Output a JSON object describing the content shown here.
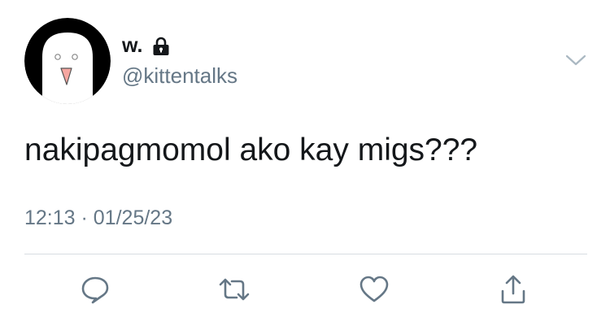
{
  "tweet": {
    "display_name": "w.",
    "handle": "@kittentalks",
    "text": "nakipagmomol ako kay migs???",
    "time": "12:13",
    "separator": "·",
    "date": "01/25/23",
    "protected_icon": "lock-icon",
    "avatar_icon": "ghost-face-avatar"
  },
  "actions": [
    {
      "icon": "reply-icon"
    },
    {
      "icon": "retweet-icon"
    },
    {
      "icon": "like-icon"
    },
    {
      "icon": "share-icon"
    }
  ],
  "colors": {
    "text_primary": "#14171a",
    "text_secondary": "#657786",
    "divider": "#d8dde2",
    "icon": "#657786",
    "avatar_bg": "#000000",
    "avatar_face": "#ffffff",
    "avatar_mouth": "#f6a6a0"
  }
}
